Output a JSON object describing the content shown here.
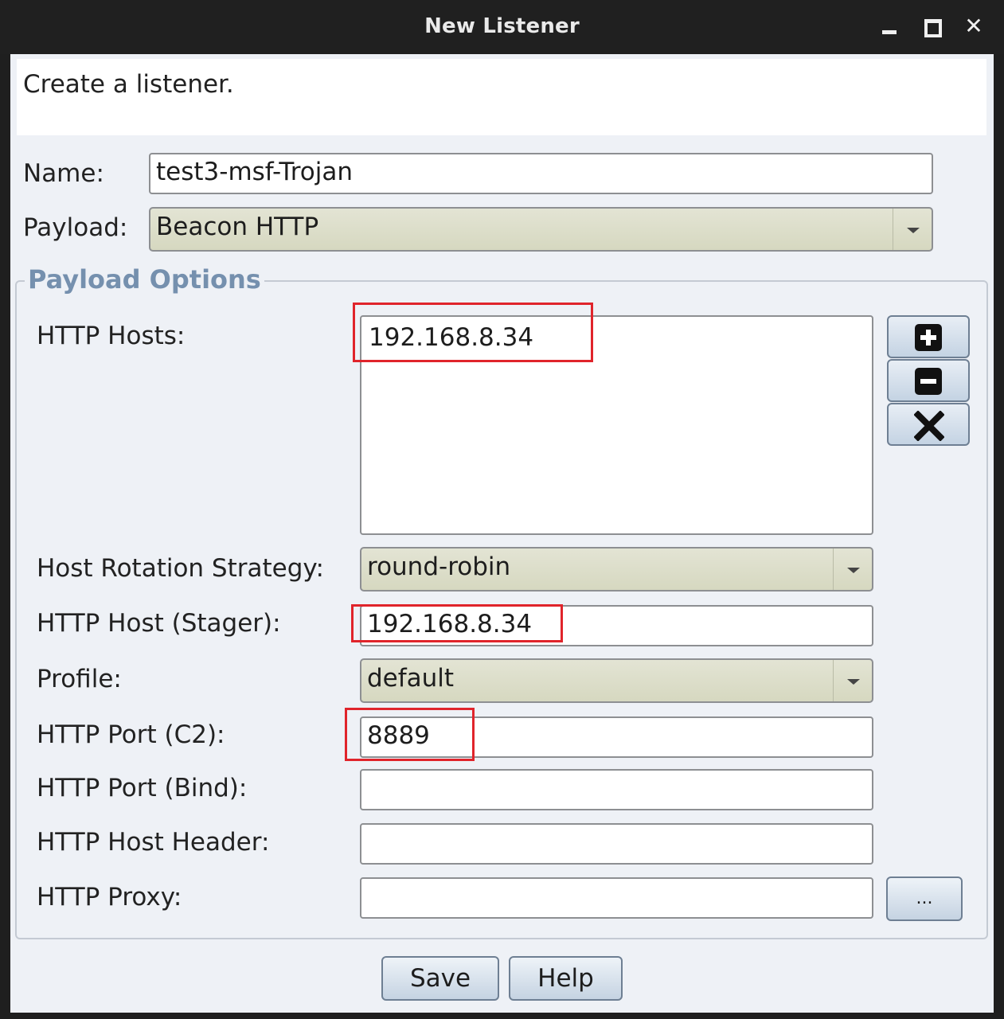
{
  "window": {
    "title": "New Listener"
  },
  "description": "Create a listener.",
  "form": {
    "name_label": "Name:",
    "name_value": "test3-msf-Trojan",
    "payload_label": "Payload:",
    "payload_value": "Beacon HTTP"
  },
  "payload_options": {
    "legend": "Payload Options",
    "http_hosts_label": "HTTP Hosts:",
    "http_hosts": [
      "192.168.8.34"
    ],
    "host_rotation_label": "Host Rotation Strategy:",
    "host_rotation_value": "round-robin",
    "stager_host_label": "HTTP Host (Stager):",
    "stager_host_value": "192.168.8.34",
    "profile_label": "Profile:",
    "profile_value": "default",
    "port_c2_label": "HTTP Port (C2):",
    "port_c2_value": "8889",
    "port_bind_label": "HTTP Port (Bind):",
    "port_bind_value": "",
    "host_header_label": "HTTP Host Header:",
    "host_header_value": "",
    "proxy_label": "HTTP Proxy:",
    "proxy_value": "",
    "proxy_button": "..."
  },
  "buttons": {
    "save": "Save",
    "help": "Help"
  },
  "colors": {
    "annotation_highlight": "#e0242b",
    "legend": "#7590ae",
    "combo_bg": "#dcdec8"
  }
}
